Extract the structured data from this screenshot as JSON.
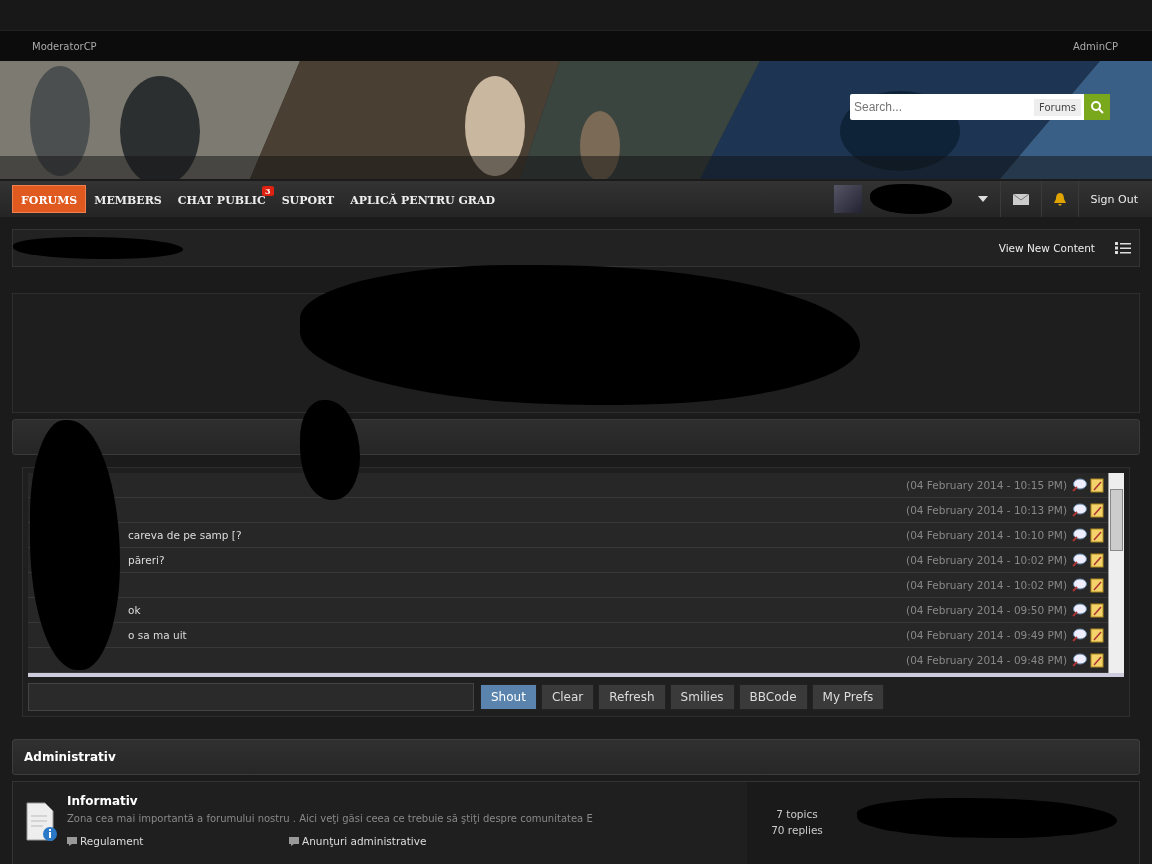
{
  "top_links": {
    "left": "ModeratorCP",
    "right": "AdminCP"
  },
  "search": {
    "placeholder": "Search...",
    "scope": "Forums"
  },
  "nav": [
    {
      "label": "FORUMS",
      "selected": true
    },
    {
      "label": "MEMBERS",
      "selected": false
    },
    {
      "label": "CHAT PUBLIC",
      "selected": false,
      "badge": "3"
    },
    {
      "label": "SUPORT",
      "selected": false
    },
    {
      "label": "APLICĂ PENTRU GRAD",
      "selected": false
    }
  ],
  "user_menu": {
    "sign_out": "Sign Out"
  },
  "breadcrumb_bar": {
    "link": "View New Content"
  },
  "shoutbox": {
    "shouts": [
      {
        "time": "(04 February 2014 - 10:15 PM)"
      },
      {
        "time": "(04 February 2014 - 10:13 PM)"
      },
      {
        "message": "careva de pe samp [?",
        "time": "(04 February 2014 - 10:10 PM)"
      },
      {
        "message": "păreri?",
        "time": "(04 February 2014 - 10:02 PM)"
      },
      {
        "time": "(04 February 2014 - 10:02 PM)"
      },
      {
        "message": "ok",
        "time": "(04 February 2014 - 09:50 PM)"
      },
      {
        "message": "o sa ma uit",
        "time": "(04 February 2014 - 09:49 PM)"
      },
      {
        "time": "(04 February 2014 - 09:48 PM)"
      }
    ],
    "buttons": [
      {
        "label": "Shout",
        "selected": true
      },
      {
        "label": "Clear",
        "selected": false
      },
      {
        "label": "Refresh",
        "selected": false
      },
      {
        "label": "Smilies",
        "selected": false
      },
      {
        "label": "BBCode",
        "selected": false
      },
      {
        "label": "My Prefs",
        "selected": false
      }
    ]
  },
  "category": {
    "title": "Administrativ",
    "forums": [
      {
        "name": "Informativ",
        "description": "Zona cea mai importantă a forumului nostru . Aici veţi găsi ceea ce trebuie să ştiţi despre comunitatea E",
        "topics": "7 topics",
        "replies": "70 replies",
        "subforums": [
          "Regulament",
          "Anunţuri administrative"
        ]
      }
    ]
  }
}
